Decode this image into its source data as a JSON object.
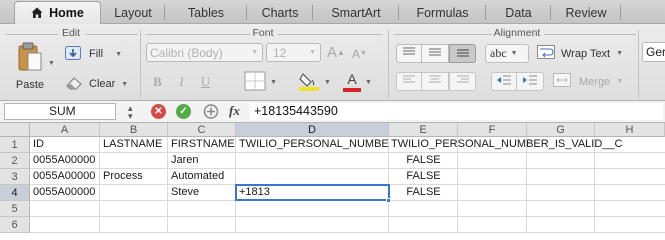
{
  "tabs": [
    {
      "label": "Home",
      "active": true
    },
    {
      "label": "Layout"
    },
    {
      "label": "Tables"
    },
    {
      "label": "Charts"
    },
    {
      "label": "SmartArt"
    },
    {
      "label": "Formulas"
    },
    {
      "label": "Data"
    },
    {
      "label": "Review"
    }
  ],
  "ribbon": {
    "groups": {
      "edit": "Edit",
      "font": "Font",
      "alignment": "Alignment"
    },
    "edit": {
      "paste": "Paste",
      "fill": "Fill",
      "clear": "Clear"
    },
    "font": {
      "name": "Calibri (Body)",
      "size": "12",
      "grow": "A",
      "shrink": "A",
      "bold": "B",
      "italic": "I",
      "underline": "U",
      "color_letter": "A"
    },
    "alignment": {
      "abc": "abc",
      "wrap_text": "Wrap Text",
      "merge": "Merge"
    },
    "number_format": "Ger"
  },
  "formula_bar": {
    "name_box": "SUM",
    "fx": "fx",
    "content": "+18135443590"
  },
  "sheet": {
    "columns": [
      "A",
      "B",
      "C",
      "D",
      "E",
      "F",
      "G",
      "H"
    ],
    "rows": [
      "1",
      "2",
      "3",
      "4",
      "5",
      "6"
    ],
    "cells": {
      "A1": "ID",
      "B1": "LASTNAME",
      "C1": "FIRSTNAME",
      "D1": "TWILIO_PERSONAL_NUMBER",
      "E1": "TWILIO_PERSONAL_NUMBER_IS_VALID__C",
      "A2": "0055A00000",
      "C2": "Jaren",
      "E2": "FALSE",
      "A3": "0055A00000",
      "B3": "Process",
      "C3": "Automated",
      "E3": "FALSE",
      "A4": "0055A00000",
      "C4": "Steve",
      "D4": "+1813",
      "E4": "FALSE"
    },
    "selected_cell": "D4"
  }
}
